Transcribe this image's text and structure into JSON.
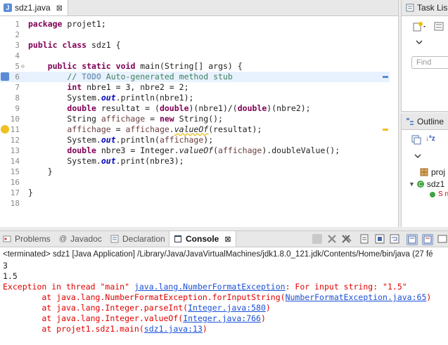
{
  "editor": {
    "tab_label": "sdz1.java",
    "tab_close": "⊠",
    "lines": [
      {
        "n": "1",
        "code": "package projet1;"
      },
      {
        "n": "2",
        "code": ""
      },
      {
        "n": "3",
        "code": "public class sdz1 {"
      },
      {
        "n": "4",
        "code": ""
      },
      {
        "n": "5",
        "code": "    public static void main(String[] args) {"
      },
      {
        "n": "6",
        "code": "        // TODO Auto-generated method stub"
      },
      {
        "n": "7",
        "code": "        int nbre1 = 3, nbre2 = 2;"
      },
      {
        "n": "8",
        "code": "        System.out.println(nbre1);"
      },
      {
        "n": "9",
        "code": "        double resultat = (double)(nbre1)/(double)(nbre2);"
      },
      {
        "n": "10",
        "code": "        String affichage = new String();"
      },
      {
        "n": "11",
        "code": "        affichage = affichage.valueOf(resultat);"
      },
      {
        "n": "12",
        "code": "        System.out.println(affichage);"
      },
      {
        "n": "13",
        "code": "        double nbre3 = Integer.valueOf(affichage).doubleValue();"
      },
      {
        "n": "14",
        "code": "        System.out.print(nbre3);"
      },
      {
        "n": "15",
        "code": "    }"
      },
      {
        "n": "16",
        "code": ""
      },
      {
        "n": "17",
        "code": "}"
      },
      {
        "n": "18",
        "code": ""
      }
    ]
  },
  "right_panels": {
    "task_list_label": "Task Lis",
    "find_placeholder": "Find",
    "outline_label": "Outline",
    "outline_items": [
      "proj",
      "sdz1",
      "S n"
    ]
  },
  "console": {
    "tabs": [
      {
        "label": "Problems",
        "icon": "problems-icon"
      },
      {
        "label": "Javadoc",
        "icon": "javadoc-icon"
      },
      {
        "label": "Declaration",
        "icon": "declaration-icon"
      },
      {
        "label": "Console",
        "icon": "console-icon",
        "active": true
      }
    ],
    "close_glyph": "⊠",
    "status": "<terminated> sdz1 [Java Application] /Library/Java/JavaVirtualMachines/jdk1.8.0_121.jdk/Contents/Home/bin/java (27 fé",
    "output": {
      "line1": "3",
      "line2": "1.5",
      "exception_prefix": "Exception in thread \"main\" ",
      "exception_class": "java.lang.NumberFormatException",
      "exception_msg": ": For input string: \"1.5\"",
      "trace": [
        {
          "pre": "\tat java.lang.NumberFormatException.forInputString(",
          "link": "NumberFormatException.java:65",
          "post": ")"
        },
        {
          "pre": "\tat java.lang.Integer.parseInt(",
          "link": "Integer.java:580",
          "post": ")"
        },
        {
          "pre": "\tat java.lang.Integer.valueOf(",
          "link": "Integer.java:766",
          "post": ")"
        },
        {
          "pre": "\tat projet1.sdz1.main(",
          "link": "sdz1.java:13",
          "post": ")"
        }
      ]
    }
  },
  "colors": {
    "keyword": "#7f0055",
    "comment": "#3f7f5f",
    "static_field": "#0000c0",
    "error": "#e00000",
    "link": "#1a4fd6",
    "current_line": "#e8f2fe"
  }
}
